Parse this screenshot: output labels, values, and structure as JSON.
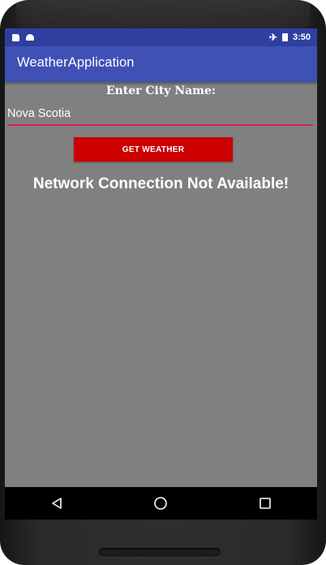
{
  "status_bar": {
    "time": "3:50",
    "icons": [
      "sd-card-icon",
      "android-icon",
      "airplane-mode-icon",
      "battery-icon"
    ]
  },
  "app_bar": {
    "title": "WeatherApplication"
  },
  "form": {
    "city_label": "Enter City Name:",
    "city_value": "Nova Scotia",
    "button_label": "GET WEATHER"
  },
  "message": "Network Connection Not Available!",
  "nav_bar": {
    "buttons": [
      "back-icon",
      "home-icon",
      "recents-icon"
    ]
  },
  "colors": {
    "status_bar": "#303f9f",
    "app_bar": "#3f51b5",
    "background": "#808080",
    "button": "#cc0000",
    "input_underline": "#d81b60"
  }
}
